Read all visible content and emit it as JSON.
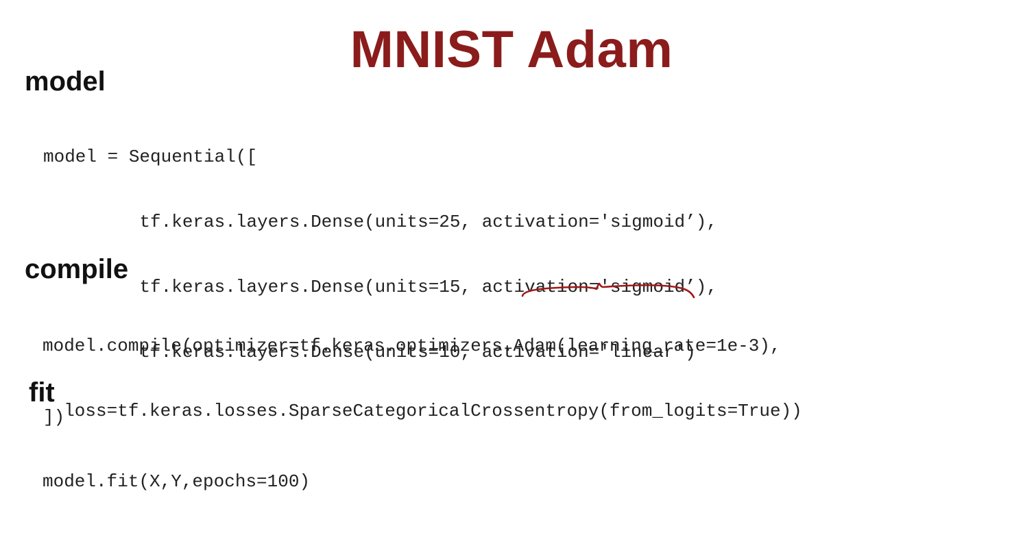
{
  "slide": {
    "title": "MNIST Adam",
    "title_color": "#8b1c1c",
    "annotation_color": "#a11818"
  },
  "sections": {
    "model": {
      "heading": "model",
      "code_lines": [
        "model = Sequential([",
        "         tf.keras.layers.Dense(units=25, activation='sigmoid’),",
        "         tf.keras.layers.Dense(units=15, activation='sigmoid’),",
        "         tf.keras.layers.Dense(units=10, activation='linear')",
        "])"
      ]
    },
    "compile": {
      "heading": "compile",
      "code_lines": [
        "model.compile(optimizer=tf.keras.optimizers.Adam(learning_rate=1e-3),",
        "  loss=tf.keras.losses.SparseCategoricalCrossentropy(from_logits=True))"
      ]
    },
    "fit": {
      "heading": "fit",
      "code_lines": [
        "model.fit(X,Y,epochs=100)"
      ]
    }
  }
}
